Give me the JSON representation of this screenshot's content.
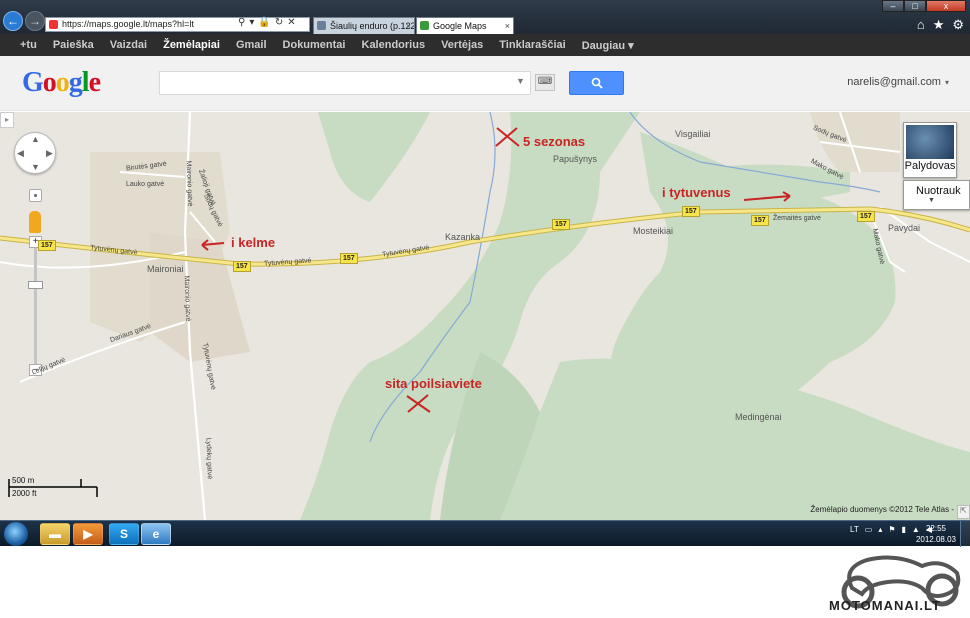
{
  "browser": {
    "address": "https://maps.google.lt/maps?hl=lt",
    "tabs": [
      {
        "label": "Šiaulių enduro (p.122) -"
      },
      {
        "label": "Google Maps"
      }
    ],
    "window_buttons": {
      "minimize": "–",
      "maximize": "□",
      "close": "x"
    }
  },
  "gbar": {
    "items": [
      "+tu",
      "Paieška",
      "Vaizdai",
      "Žemėlapiai",
      "Gmail",
      "Dokumentai",
      "Kalendorius",
      "Vertėjas",
      "Tinklaraščiai",
      "Daugiau ▾"
    ],
    "active_index": 3
  },
  "header": {
    "logo": "Google",
    "search_value": "",
    "user_email": "narelis@gmail.com"
  },
  "map": {
    "places": [
      "Visgailiai",
      "Papušynys",
      "Kazanka",
      "Mosteikiai",
      "Maironiai",
      "Pavydai",
      "Medingėnai"
    ],
    "streets": [
      "Tytuvėnų gatvė",
      "Tytuvėnų gatvė",
      "Tytuvėnų gatvė",
      "Žemaitės gatvė",
      "Birutės gatvė",
      "Lauko gatvė",
      "Sodų gatvė",
      "Žalioji gatvė",
      "Maironio gatvė",
      "Lelijų gatvė",
      "Dariaus gatvė",
      "Maironio gatvė",
      "Lydekų gatvė",
      "Sodų gatvė",
      "Mako gatvė",
      "Mako gatvė",
      "Tytuvėnų gatvė"
    ],
    "route_number": "157",
    "annotations": {
      "kelme": "i kelme",
      "sezonas": "5 sezonas",
      "tytuvenus": "i tytuvenus",
      "poilsiaviete": "sita poilsiaviete"
    },
    "satellite_label": "Palydovas",
    "photos_label": "Nuotrauk",
    "scale_metric": "500 m",
    "scale_imperial": "2000 ft",
    "copyright": "Žemėlapio duomenys ©2012 Tele Atlas -"
  },
  "taskbar": {
    "language": "LT",
    "time": "22:55",
    "date": "2012.08.03"
  },
  "watermark": {
    "text": "MOTOMANAI.LT"
  },
  "colors": {
    "forest": "#c8dcc3",
    "land": "#e9e6df",
    "road": "#f6e88a",
    "annotation": "#c82424",
    "search_button": "#4d90fe"
  }
}
